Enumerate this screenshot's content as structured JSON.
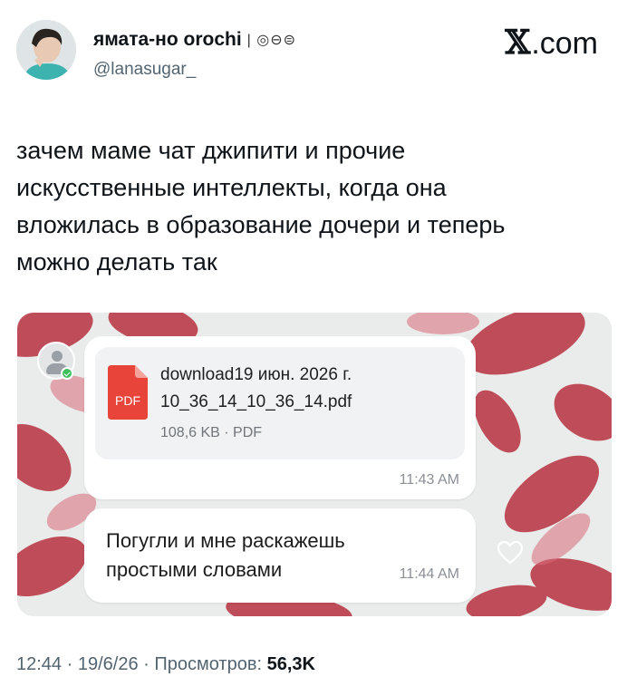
{
  "author": {
    "display_name": "ямата-но orochi",
    "name_suffix": "| ◎⊖⊜",
    "handle": "@lanasugar_"
  },
  "brand": {
    "mark": "𝕏",
    "text": ".com"
  },
  "tweet": {
    "text": "зачем маме чат джипити и прочие\nискусственные интеллекты, когда она\nвложилась в образование дочери и теперь\nможно делать так"
  },
  "chat": {
    "file_message": {
      "file_name": "download19 июн. 2026 г. 10_36_14_10_36_14.pdf",
      "file_badge": "PDF",
      "file_meta": "108,6 KB · PDF",
      "time": "11:43 AM"
    },
    "text_message": {
      "text": "Погугли и мне раскажешь простыми словами",
      "time": "11:44 AM"
    },
    "colors": {
      "pdf_red": "#e8443a",
      "online_green": "#3fbf5c"
    }
  },
  "footer": {
    "time": "12:44",
    "date": "19/6/26",
    "views_label": "Просмотров:",
    "views_value": "56,3K"
  }
}
